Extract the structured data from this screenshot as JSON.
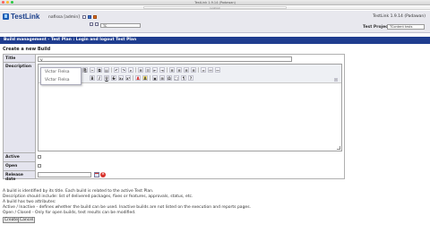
{
  "window": {
    "title": "TestLink 1.9.14 (Padawan)",
    "url": "localhost"
  },
  "header": {
    "logo_text": "TestLink",
    "user": "nafissa [admin]",
    "version": "TestLink 1.9.14 (Padawan)",
    "test_project_label": "Test Project",
    "test_project_value": "TContent tests",
    "project_select_small": "TC"
  },
  "breadcrumb": "Build management - Test Plan : Login and logout Test Plan",
  "page": {
    "section_title": "Create a new Build",
    "labels": {
      "title": "Title",
      "description": "Description",
      "active": "Active",
      "open": "Open",
      "release_date": "Release date"
    },
    "title_value": "V",
    "editor_dropdown": [
      "Victor Flelsa",
      "Victor Flelsa"
    ],
    "notes": [
      "A build is identified by its title. Each build is related to the active Test Plan.",
      "Description should include: list of delivered packages, fixes or features, approvals, status, etc.",
      "A build has two attributes:",
      "Active / Inactive - defines whether the build can be used. Inactive builds are not listed on the execution and reports pages.",
      "Open / Closed - Only for open builds, test results can be modified."
    ],
    "buttons": {
      "create": "Create",
      "cancel": "Cancel"
    }
  },
  "colors": {
    "breadcrumb_bg": "#1f3d8f",
    "label_bg": "#e4e4ee",
    "header_bg": "#e8e8ee"
  }
}
